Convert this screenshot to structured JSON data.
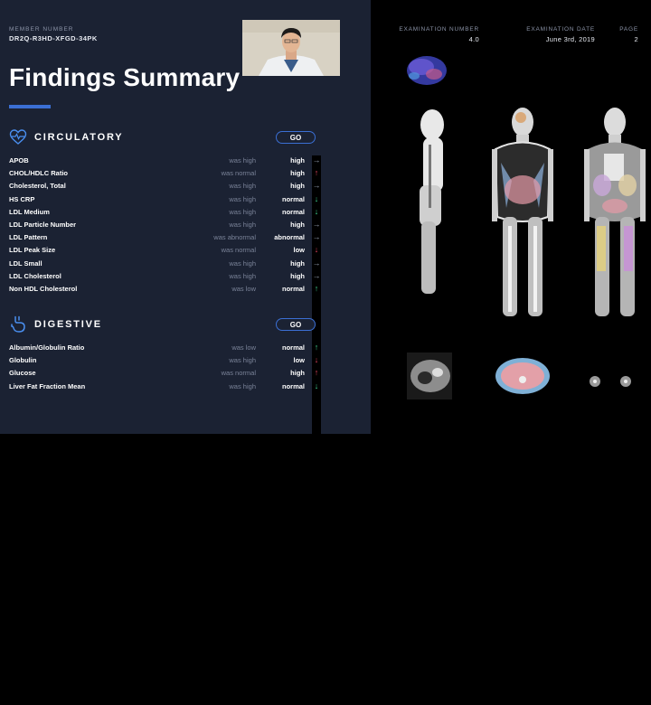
{
  "member": {
    "label": "MEMBER NUMBER",
    "number": "DR2Q-R3HD-XFGD-34PK"
  },
  "page_title": "Findings Summary",
  "exam": {
    "number_label": "EXAMINATION NUMBER",
    "number_value": "4.0",
    "date_label": "EXAMINATION DATE",
    "date_value": "June 3rd, 2019",
    "page_label": "PAGE",
    "page_value": "2"
  },
  "sections": [
    {
      "title": "CIRCULATORY",
      "icon": "heart-pulse-icon",
      "go_label": "GO",
      "rows": [
        {
          "name": "APOB",
          "prev": "was high",
          "status": "high",
          "trend": "flat"
        },
        {
          "name": "CHOL/HDLC Ratio",
          "prev": "was normal",
          "status": "high",
          "trend": "up"
        },
        {
          "name": "Cholesterol, Total",
          "prev": "was high",
          "status": "high",
          "trend": "flat"
        },
        {
          "name": "HS CRP",
          "prev": "was high",
          "status": "normal",
          "trend": "down"
        },
        {
          "name": "LDL Medium",
          "prev": "was high",
          "status": "normal",
          "trend": "down"
        },
        {
          "name": "LDL Particle Number",
          "prev": "was high",
          "status": "high",
          "trend": "flat"
        },
        {
          "name": "LDL Pattern",
          "prev": "was abnormal",
          "status": "abnormal",
          "trend": "flat"
        },
        {
          "name": "LDL Peak Size",
          "prev": "was normal",
          "status": "low",
          "trend": "down-red"
        },
        {
          "name": "LDL Small",
          "prev": "was high",
          "status": "high",
          "trend": "flat"
        },
        {
          "name": "LDL Cholesterol",
          "prev": "was high",
          "status": "high",
          "trend": "flat"
        },
        {
          "name": "Non HDL Cholesterol",
          "prev": "was low",
          "status": "normal",
          "trend": "up-green"
        }
      ]
    },
    {
      "title": "DIGESTIVE",
      "icon": "stomach-icon",
      "go_label": "GO",
      "rows": [
        {
          "name": "Albumin/Globulin Ratio",
          "prev": "was low",
          "status": "normal",
          "trend": "up-green"
        },
        {
          "name": "Globulin",
          "prev": "was high",
          "status": "low",
          "trend": "down-red"
        },
        {
          "name": "Glucose",
          "prev": "was normal",
          "status": "high",
          "trend": "up"
        },
        {
          "name": "Liver Fat Fraction Mean",
          "prev": "was high",
          "status": "normal",
          "trend": "down"
        }
      ]
    }
  ],
  "colors": {
    "panel_bg": "#1b2233",
    "accent": "#3b6fd4",
    "trend_up_bad": "#e0435c",
    "trend_good": "#3fcf8e",
    "trend_flat": "#8e96a8"
  }
}
